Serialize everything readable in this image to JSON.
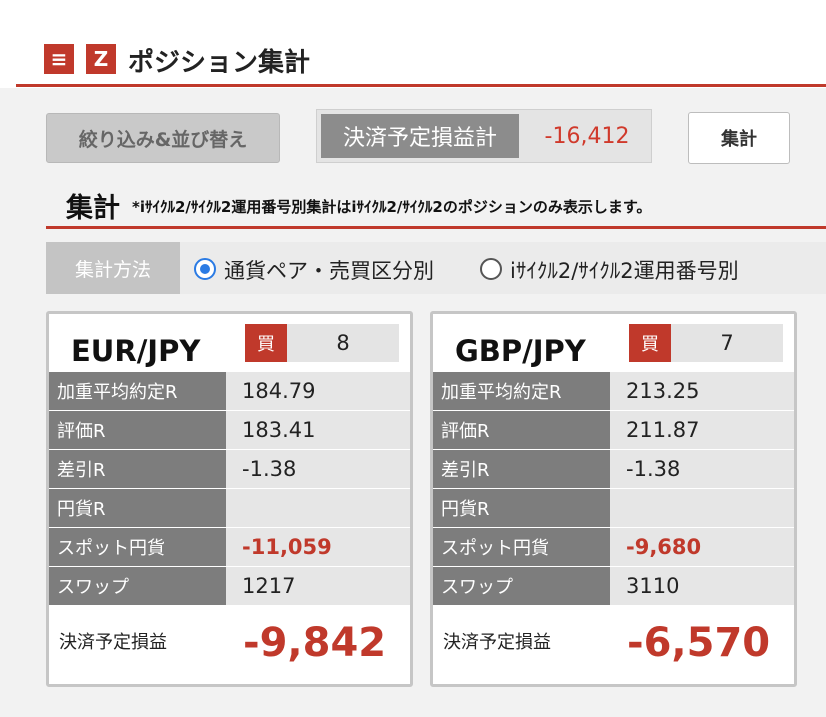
{
  "header": {
    "title": "ポジション集計",
    "menu_icon": "≡",
    "z_icon": "Z"
  },
  "toolbar": {
    "filter_label": "絞り込み&並び替え",
    "pl_total_label": "決済予定損益計",
    "pl_total_value": "-16,412",
    "sum_label": "集計"
  },
  "section": {
    "title": "集計",
    "note": "*iｻｲｸﾙ2/ｻｲｸﾙ2運用番号別集計はiｻｲｸﾙ2/ｻｲｸﾙ2のポジションのみ表示します。"
  },
  "method": {
    "label": "集計方法",
    "options": [
      {
        "label": "通貨ペア・売買区分別",
        "selected": true
      },
      {
        "label": "iｻｲｸﾙ2/ｻｲｸﾙ2運用番号別",
        "selected": false
      }
    ]
  },
  "cards": [
    {
      "pair": "EUR/JPY",
      "side": "買",
      "qty": "8",
      "rows": [
        {
          "label": "加重平均約定R",
          "value": "184.79"
        },
        {
          "label": "評価R",
          "value": "183.41"
        },
        {
          "label": "差引R",
          "value": "-1.38"
        },
        {
          "label": "円貨R",
          "value": ""
        },
        {
          "label": "スポット円貨",
          "value": "-11,059"
        },
        {
          "label": "スワップ",
          "value": "1217"
        }
      ],
      "pl_label": "決済予定損益",
      "pl_value": "-9,842"
    },
    {
      "pair": "GBP/JPY",
      "side": "買",
      "qty": "7",
      "rows": [
        {
          "label": "加重平均約定R",
          "value": "213.25"
        },
        {
          "label": "評価R",
          "value": "211.87"
        },
        {
          "label": "差引R",
          "value": "-1.38"
        },
        {
          "label": "円貨R",
          "value": ""
        },
        {
          "label": "スポット円貨",
          "value": "-9,680"
        },
        {
          "label": "スワップ",
          "value": "3110"
        }
      ],
      "pl_label": "決済予定損益",
      "pl_value": "-6,570"
    }
  ],
  "colors": {
    "accent": "#c0392b",
    "radio": "#2b7be4"
  }
}
